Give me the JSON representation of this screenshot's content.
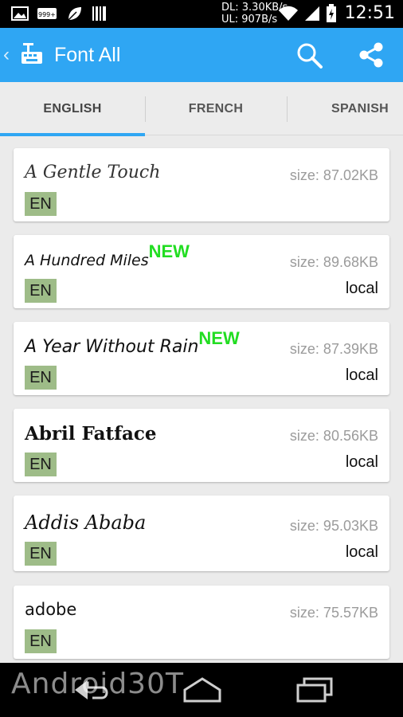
{
  "status_bar": {
    "notif_badge": "999+",
    "dl_speed": "DL: 3.30KB/s",
    "ul_speed": "UL: 907B/s",
    "time": "12:51",
    "icons": [
      "image-icon",
      "badge-icon",
      "leaf-icon",
      "barcode-icon",
      "wifi-icon",
      "signal-icon",
      "battery-icon"
    ]
  },
  "action_bar": {
    "title": "Font All",
    "back_icon": "chevron-left-icon",
    "app_icon": "font-app-icon",
    "search_icon": "search-icon",
    "share_icon": "share-icon",
    "color": "#2fa6f3"
  },
  "tabs": [
    {
      "label": "ENGLISH",
      "selected": true
    },
    {
      "label": "FRENCH",
      "selected": false
    },
    {
      "label": "SPANISH",
      "selected": false
    }
  ],
  "fonts": [
    {
      "name": "A Gentle Touch",
      "is_new": false,
      "new_label": "",
      "lang": "EN",
      "size": "size: 87.02KB",
      "status": ""
    },
    {
      "name": "A Hundred Miles",
      "is_new": true,
      "new_label": "NEW",
      "lang": "EN",
      "size": "size: 89.68KB",
      "status": "local"
    },
    {
      "name": "A Year Without Rain",
      "is_new": true,
      "new_label": "NEW",
      "lang": "EN",
      "size": "size: 87.39KB",
      "status": "local"
    },
    {
      "name": "Abril Fatface",
      "is_new": false,
      "new_label": "",
      "lang": "EN",
      "size": "size: 80.56KB",
      "status": "local"
    },
    {
      "name": "Addis Ababa",
      "is_new": false,
      "new_label": "",
      "lang": "EN",
      "size": "size: 95.03KB",
      "status": "local"
    },
    {
      "name": "adobe",
      "is_new": false,
      "new_label": "",
      "lang": "EN",
      "size": "size: 75.57KB",
      "status": ""
    }
  ],
  "colors": {
    "new_badge": "#22dd22",
    "lang_badge": "#9ebc88",
    "size_text": "#9b9b9b"
  },
  "nav_bar": {
    "icons": [
      "back-icon",
      "home-icon",
      "recent-apps-icon"
    ]
  },
  "watermark": "Android30T"
}
